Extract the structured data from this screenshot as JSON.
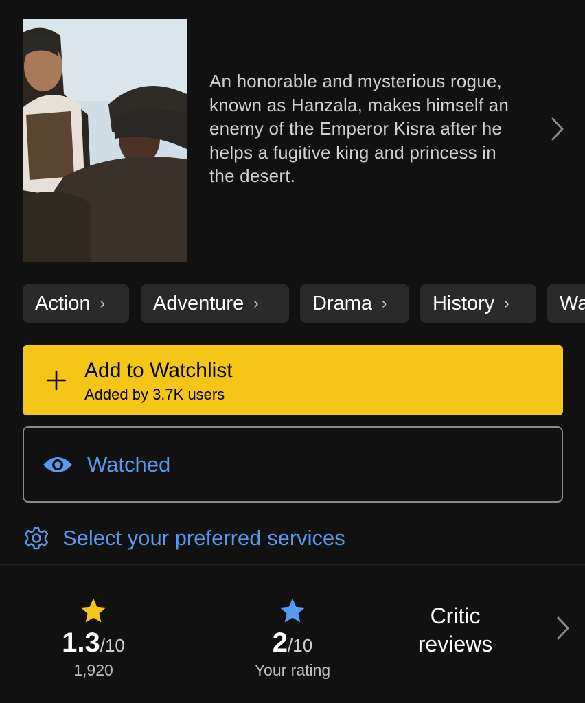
{
  "synopsis": "An honorable and mysterious rogue, known as Hanzala, makes himself an enemy of the Emperor Kisra after he helps a fugitive king and princess in the desert.",
  "genres": [
    "Action",
    "Adventure",
    "Drama",
    "History",
    "Wa"
  ],
  "watchlist": {
    "label": "Add to Watchlist",
    "added_by": "Added by 3.7K users",
    "color": "#f5c518"
  },
  "watched": {
    "label": "Watched",
    "color": "#5799ef"
  },
  "services": {
    "label": "Select your preferred services"
  },
  "ratings": {
    "imdb": {
      "value": "1.3",
      "scale": "/10",
      "count": "1,920",
      "star_color": "#f5c518"
    },
    "user": {
      "value": "2",
      "scale": "/10",
      "label": "Your rating",
      "star_color": "#5799ef"
    },
    "critic": {
      "line1": "Critic",
      "line2": "reviews"
    }
  },
  "icons": [
    "chevron-right-icon",
    "plus-icon",
    "eye-icon",
    "gear-icon",
    "star-icon"
  ]
}
